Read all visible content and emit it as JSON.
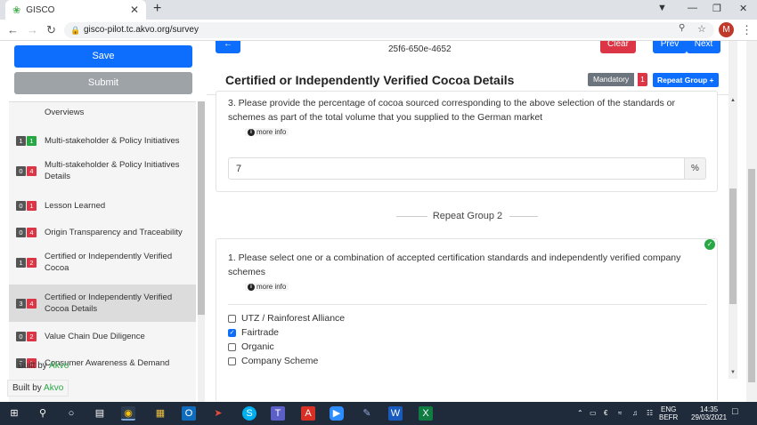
{
  "browser": {
    "tab_title": "GISCO",
    "url": "gisco-pilot.tc.akvo.org/survey",
    "profile_initial": "M"
  },
  "sidebar": {
    "save_label": "Save",
    "submit_label": "Submit",
    "items": [
      {
        "badge_a": "",
        "badge_b": "",
        "label": "Overviews"
      },
      {
        "badge_a": "1",
        "badge_b": "1",
        "label": "Multi-stakeholder & Policy Initiatives"
      },
      {
        "badge_a": "0",
        "badge_b": "4",
        "label": "Multi-stakeholder & Policy Initiatives Details"
      },
      {
        "badge_a": "0",
        "badge_b": "1",
        "label": "Lesson Learned"
      },
      {
        "badge_a": "0",
        "badge_b": "4",
        "label": "Origin Transparency and Traceability"
      },
      {
        "badge_a": "1",
        "badge_b": "2",
        "label": "Certified or Independently Verified Cocoa"
      },
      {
        "badge_a": "3",
        "badge_b": "4",
        "label": "Certified or Independently Verified Cocoa Details"
      },
      {
        "badge_a": "0",
        "badge_b": "2",
        "label": "Value Chain Due Diligence"
      },
      {
        "badge_a": "0",
        "badge_b": "1",
        "label": "Consumer Awareness & Demand"
      }
    ],
    "built_by_prefix": "Built by",
    "built_by_brand": "Akvo"
  },
  "main": {
    "uuid": "25f6-650e-4652",
    "clear_label": "Clear",
    "prev_label": "Prev",
    "next_label": "Next",
    "group_title": "Certified or Independently Verified Cocoa Details",
    "mandatory_label": "Mandatory",
    "mandatory_count": "1",
    "repeat_group_label": "Repeat Group +",
    "q3": {
      "text": "3.   Please provide the percentage of cocoa sourced corresponding to the above selection of the standards or schemes as part of the total volume that you supplied to the German market",
      "more_info": "more info",
      "value": "7",
      "unit": "%"
    },
    "repeat_group_2_label": "Repeat Group 2",
    "q1": {
      "text": "1.   Please select one or a combination of accepted certification standards and independently verified company schemes",
      "more_info": "more info",
      "options": [
        {
          "label": "UTZ / Rainforest Alliance",
          "checked": false
        },
        {
          "label": "Fairtrade",
          "checked": true
        },
        {
          "label": "Organic",
          "checked": false
        },
        {
          "label": "Company Scheme",
          "checked": false
        }
      ]
    }
  },
  "footer": {
    "built_by_prefix": "Built by",
    "built_by_brand": "Akvo"
  },
  "taskbar": {
    "lang_top": "ENG",
    "lang_bottom": "BEFR",
    "time": "14:35",
    "date": "29/03/2021"
  }
}
